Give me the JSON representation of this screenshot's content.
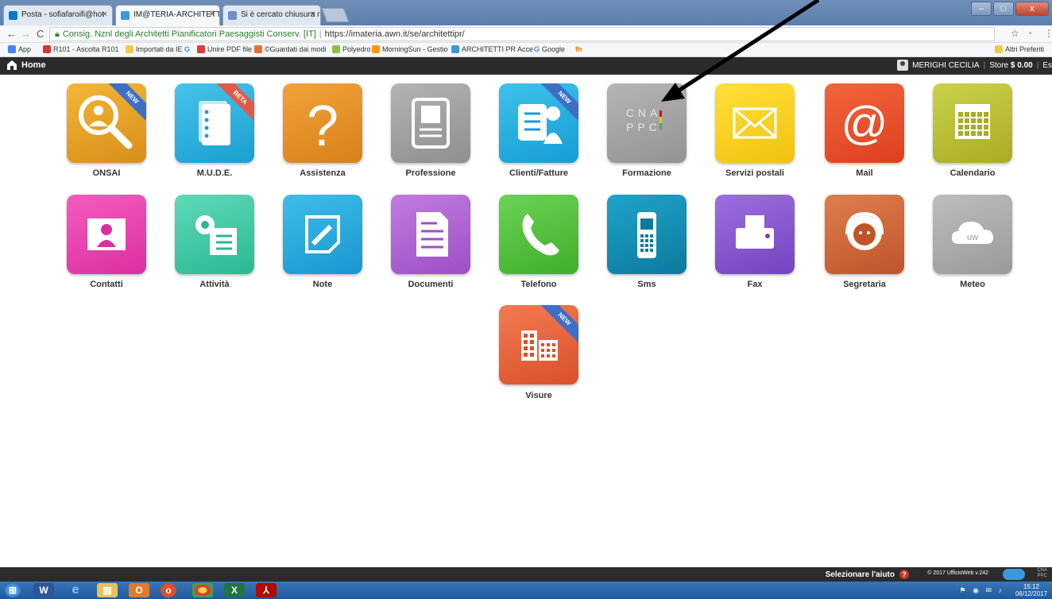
{
  "browser": {
    "tabs": [
      {
        "label": "Posta - sofiafaroifi@hot",
        "color": "#0078d4"
      },
      {
        "label": "IM@TERIA-ARCHITETTI",
        "color": "#3a9ad9"
      },
      {
        "label": "Si è cercato chiusura nat",
        "color": "#6a8fc9"
      }
    ],
    "url_site": "Consig. Nznl degli Architetti Pianificatori Paesaggisti Conserv. [IT]",
    "url_path": "https://imateria.awn.it/se/architettipr/",
    "bookmarks": [
      {
        "label": "App",
        "color": "#4285f4"
      },
      {
        "label": "R101 - Ascolta R101",
        "color": "#d33"
      },
      {
        "label": "Importati da IE",
        "color": "#f2c94c"
      },
      {
        "label": "G",
        "color": "#4285f4"
      },
      {
        "label": "Unire PDF file",
        "color": "#e53935"
      },
      {
        "label": "©Guardati dai modi",
        "color": "#e8702a"
      },
      {
        "label": "Polyedro",
        "color": "#8bc34a"
      },
      {
        "label": "MorningSun - Gestio",
        "color": "#ff9800"
      },
      {
        "label": "ARCHITETTI PR Acce",
        "color": "#3a9ad9"
      },
      {
        "label": "Google",
        "color": "#4285f4"
      },
      {
        "label": "fh",
        "color": "#f57c00"
      }
    ],
    "other_bookmarks": "Altri Preferiti"
  },
  "header": {
    "home_label": "Home",
    "user_name": "MERIGHI CECILIA",
    "store_label": "Store",
    "store_amount": "$ 0.00",
    "extra": "Es"
  },
  "tiles": [
    {
      "label": "ONSAI",
      "color1": "#f2b63b",
      "color2": "#d98e17",
      "icon": "search-worker-icon",
      "badge": "NEW"
    },
    {
      "label": "M.U.D.E.",
      "color1": "#47c3ea",
      "color2": "#1a9fd1",
      "icon": "documents-icon",
      "badge": "BETA"
    },
    {
      "label": "Assistenza",
      "color1": "#f0a33a",
      "color2": "#d9801a",
      "icon": "question-icon",
      "badge": ""
    },
    {
      "label": "Professione",
      "color1": "#b3b3b3",
      "color2": "#8f8f8f",
      "icon": "id-card-icon",
      "badge": ""
    },
    {
      "label": "Clienti/Fatture",
      "color1": "#3fc1ea",
      "color2": "#149ed4",
      "icon": "clients-invoice-icon",
      "badge": "NEW"
    },
    {
      "label": "Formazione",
      "color1": "#b5b5b5",
      "color2": "#939393",
      "icon": "cnappc-logo-icon",
      "badge": ""
    },
    {
      "label": "Servizi postali",
      "color1": "#ffe03a",
      "color2": "#f2c20e",
      "icon": "envelope-icon",
      "badge": ""
    },
    {
      "label": "Mail",
      "color1": "#f2663d",
      "color2": "#de3f1e",
      "icon": "at-sign-icon",
      "badge": ""
    },
    {
      "label": "Calendario",
      "color1": "#cbd14a",
      "color2": "#a8ad22",
      "icon": "calendar-icon",
      "badge": ""
    },
    {
      "label": "Contatti",
      "color1": "#f45cbf",
      "color2": "#db2f9f",
      "icon": "contact-card-icon",
      "badge": ""
    },
    {
      "label": "Attività",
      "color1": "#5fd9b9",
      "color2": "#2bb892",
      "icon": "gear-checklist-icon",
      "badge": ""
    },
    {
      "label": "Note",
      "color1": "#3fbde9",
      "color2": "#1797cf",
      "icon": "note-pencil-icon",
      "badge": ""
    },
    {
      "label": "Documenti",
      "color1": "#c07ce0",
      "color2": "#9d4fc7",
      "icon": "document-icon",
      "badge": ""
    },
    {
      "label": "Telefono",
      "color1": "#6cd355",
      "color2": "#3fae2a",
      "icon": "phone-icon",
      "badge": ""
    },
    {
      "label": "Sms",
      "color1": "#1fa3c9",
      "color2": "#0c7a9f",
      "icon": "mobile-phone-icon",
      "badge": ""
    },
    {
      "label": "Fax",
      "color1": "#9c6fde",
      "color2": "#7443c1",
      "icon": "fax-icon",
      "badge": ""
    },
    {
      "label": "Segretaria",
      "color1": "#df7e4f",
      "color2": "#bf5429",
      "icon": "headset-operator-icon",
      "badge": ""
    },
    {
      "label": "Meteo",
      "color1": "#bdbdbd",
      "color2": "#9a9a9a",
      "icon": "cloud-icon",
      "badge": ""
    },
    {
      "label": "Visure",
      "color1": "#f37a52",
      "color2": "#d9502a",
      "icon": "buildings-icon",
      "badge": "NEW"
    }
  ],
  "cnappc": {
    "line1": "CNA",
    "line2": "PPC"
  },
  "meteo_text": "uw",
  "footer": {
    "help_label": "Selezionare l'aiuto",
    "copyright": "© 2017 UfficioWeb v.242",
    "logo_top": "CNA",
    "logo_bottom": "PPC"
  },
  "taskbar": {
    "time": "15:12",
    "date": "06/12/2017"
  },
  "window_controls": {
    "minimize": "–",
    "maximize": "□",
    "close": "x"
  }
}
